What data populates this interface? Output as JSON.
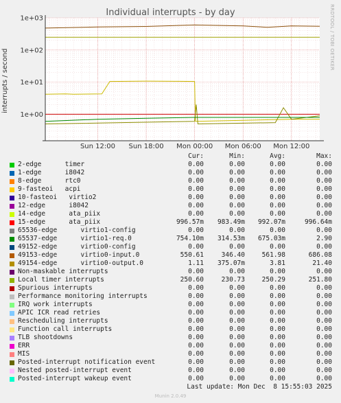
{
  "chart_data": {
    "type": "line",
    "title": "Individual interrupts - by day",
    "ylabel": "interrupts / second",
    "yscale": "log",
    "ylim": [
      0.15,
      1000
    ],
    "y_tick_labels": [
      "1e+00",
      "1e+01",
      "1e+02",
      "1e+03"
    ],
    "y_tick_values": [
      1,
      10,
      100,
      1000
    ],
    "x_tick_labels": [
      "Sun 12:00",
      "Sun 18:00",
      "Mon 00:00",
      "Mon 06:00",
      "Mon 12:00"
    ],
    "x_tick_hours": [
      12,
      18,
      24,
      30,
      36
    ],
    "xlim_hours": [
      5.5,
      39.5
    ],
    "grid": true,
    "series": [
      {
        "name": "15-edge ata_piix",
        "color": "#cc0000",
        "values": [
          [
            5.5,
            1.0
          ],
          [
            39.5,
            1.0
          ]
        ]
      },
      {
        "name": "65537-edge virtio1-req.0",
        "color": "#ccbb00",
        "values": [
          [
            5.5,
            4.2
          ],
          [
            8.0,
            4.3
          ],
          [
            9.0,
            4.2
          ],
          [
            12.5,
            4.3
          ],
          [
            13.5,
            10.5
          ],
          [
            18.0,
            10.8
          ],
          [
            22.0,
            10.6
          ],
          [
            24.0,
            10.5
          ],
          [
            24.1,
            0.6
          ],
          [
            30.0,
            0.65
          ],
          [
            36.0,
            0.7
          ],
          [
            39.5,
            0.7
          ]
        ]
      },
      {
        "name": "49153-edge virtio0-input.0",
        "color": "#8c4f0a",
        "values": [
          [
            5.5,
            480
          ],
          [
            12.0,
            520
          ],
          [
            18.0,
            540
          ],
          [
            24.0,
            600
          ],
          [
            30.0,
            560
          ],
          [
            33.0,
            510
          ],
          [
            36.0,
            560
          ],
          [
            39.5,
            550
          ]
        ]
      },
      {
        "name": "49154-edge virtio0-output.0",
        "color": "#8c8c00",
        "values": [
          [
            5.5,
            0.5
          ],
          [
            24.0,
            0.6
          ],
          [
            24.2,
            2.0
          ],
          [
            24.4,
            0.5
          ],
          [
            34.0,
            0.55
          ],
          [
            35.0,
            1.6
          ],
          [
            36.0,
            0.7
          ],
          [
            39.5,
            0.9
          ]
        ]
      },
      {
        "name": "Local timer interrupts",
        "color": "#a0a000",
        "values": [
          [
            5.5,
            250
          ],
          [
            39.5,
            250
          ]
        ]
      },
      {
        "name": "65536-edge virtio1-config",
        "color": "#008800",
        "values": [
          [
            5.5,
            0.6
          ],
          [
            12.0,
            0.7
          ],
          [
            18.0,
            0.75
          ],
          [
            24.0,
            0.8
          ],
          [
            39.5,
            0.8
          ]
        ]
      }
    ]
  },
  "labels": {
    "watermark": "RRDTOOL / TOBI OETIKER",
    "col_cur": "Cur:",
    "col_min": "Min:",
    "col_avg": "Avg:",
    "col_max": "Max:",
    "last_update": "Last update: Mon Dec  8 15:55:03 2025",
    "munin_version": "Munin 2.0.49"
  },
  "legend": [
    {
      "name": "2-edge      timer",
      "color": "#00cc00",
      "cur": "0.00",
      "min": "0.00",
      "avg": "0.00",
      "max": "0.00"
    },
    {
      "name": "1-edge      i8042",
      "color": "#0066b3",
      "cur": "0.00",
      "min": "0.00",
      "avg": "0.00",
      "max": "0.00"
    },
    {
      "name": "8-edge      rtc0",
      "color": "#ff8000",
      "cur": "0.00",
      "min": "0.00",
      "avg": "0.00",
      "max": "0.00"
    },
    {
      "name": "9-fasteoi   acpi",
      "color": "#ffcc00",
      "cur": "0.00",
      "min": "0.00",
      "avg": "0.00",
      "max": "0.00"
    },
    {
      "name": "10-fasteoi   virtio2",
      "color": "#330099",
      "cur": "0.00",
      "min": "0.00",
      "avg": "0.00",
      "max": "0.00"
    },
    {
      "name": "12-edge      i8042",
      "color": "#990099",
      "cur": "0.00",
      "min": "0.00",
      "avg": "0.00",
      "max": "0.00"
    },
    {
      "name": "14-edge      ata_piix",
      "color": "#ccff00",
      "cur": "0.00",
      "min": "0.00",
      "avg": "0.00",
      "max": "0.00"
    },
    {
      "name": "15-edge      ata_piix",
      "color": "#ff0000",
      "cur": "996.57m",
      "min": "983.49m",
      "avg": "992.07m",
      "max": "996.64m"
    },
    {
      "name": "65536-edge      virtio1-config",
      "color": "#808080",
      "cur": "0.00",
      "min": "0.00",
      "avg": "0.00",
      "max": "0.00"
    },
    {
      "name": "65537-edge      virtio1-req.0",
      "color": "#008f00",
      "cur": "754.10m",
      "min": "314.53m",
      "avg": "675.03m",
      "max": "2.90"
    },
    {
      "name": "49152-edge      virtio0-config",
      "color": "#00487d",
      "cur": "0.00",
      "min": "0.00",
      "avg": "0.00",
      "max": "0.00"
    },
    {
      "name": "49153-edge      virtio0-input.0",
      "color": "#b35a00",
      "cur": "550.61",
      "min": "346.40",
      "avg": "561.98",
      "max": "686.08"
    },
    {
      "name": "49154-edge      virtio0-output.0",
      "color": "#b38f00",
      "cur": "1.11",
      "min": "375.07m",
      "avg": "3.81",
      "max": "21.40"
    },
    {
      "name": "Non-maskable interrupts",
      "color": "#6b006b",
      "cur": "0.00",
      "min": "0.00",
      "avg": "0.00",
      "max": "0.00"
    },
    {
      "name": "Local timer interrupts",
      "color": "#8fb300",
      "cur": "250.60",
      "min": "230.73",
      "avg": "250.29",
      "max": "251.80"
    },
    {
      "name": "Spurious interrupts",
      "color": "#b30000",
      "cur": "0.00",
      "min": "0.00",
      "avg": "0.00",
      "max": "0.00"
    },
    {
      "name": "Performance monitoring interrupts",
      "color": "#bebebe",
      "cur": "0.00",
      "min": "0.00",
      "avg": "0.00",
      "max": "0.00"
    },
    {
      "name": "IRQ work interrupts",
      "color": "#80ff80",
      "cur": "0.00",
      "min": "0.00",
      "avg": "0.00",
      "max": "0.00"
    },
    {
      "name": "APIC ICR read retries",
      "color": "#80c9ff",
      "cur": "0.00",
      "min": "0.00",
      "avg": "0.00",
      "max": "0.00"
    },
    {
      "name": "Rescheduling interrupts",
      "color": "#ffc080",
      "cur": "0.00",
      "min": "0.00",
      "avg": "0.00",
      "max": "0.00"
    },
    {
      "name": "Function call interrupts",
      "color": "#ffe680",
      "cur": "0.00",
      "min": "0.00",
      "avg": "0.00",
      "max": "0.00"
    },
    {
      "name": "TLB shootdowns",
      "color": "#aa80ff",
      "cur": "0.00",
      "min": "0.00",
      "avg": "0.00",
      "max": "0.00"
    },
    {
      "name": "ERR",
      "color": "#ee00cc",
      "cur": "0.00",
      "min": "0.00",
      "avg": "0.00",
      "max": "0.00"
    },
    {
      "name": "MIS",
      "color": "#ff8080",
      "cur": "0.00",
      "min": "0.00",
      "avg": "0.00",
      "max": "0.00"
    },
    {
      "name": "Posted-interrupt notification event",
      "color": "#666600",
      "cur": "0.00",
      "min": "0.00",
      "avg": "0.00",
      "max": "0.00"
    },
    {
      "name": "Nested posted-interrupt event",
      "color": "#ffbfff",
      "cur": "0.00",
      "min": "0.00",
      "avg": "0.00",
      "max": "0.00"
    },
    {
      "name": "Posted-interrupt wakeup event",
      "color": "#00ffcc",
      "cur": "0.00",
      "min": "0.00",
      "avg": "0.00",
      "max": "0.00"
    }
  ]
}
